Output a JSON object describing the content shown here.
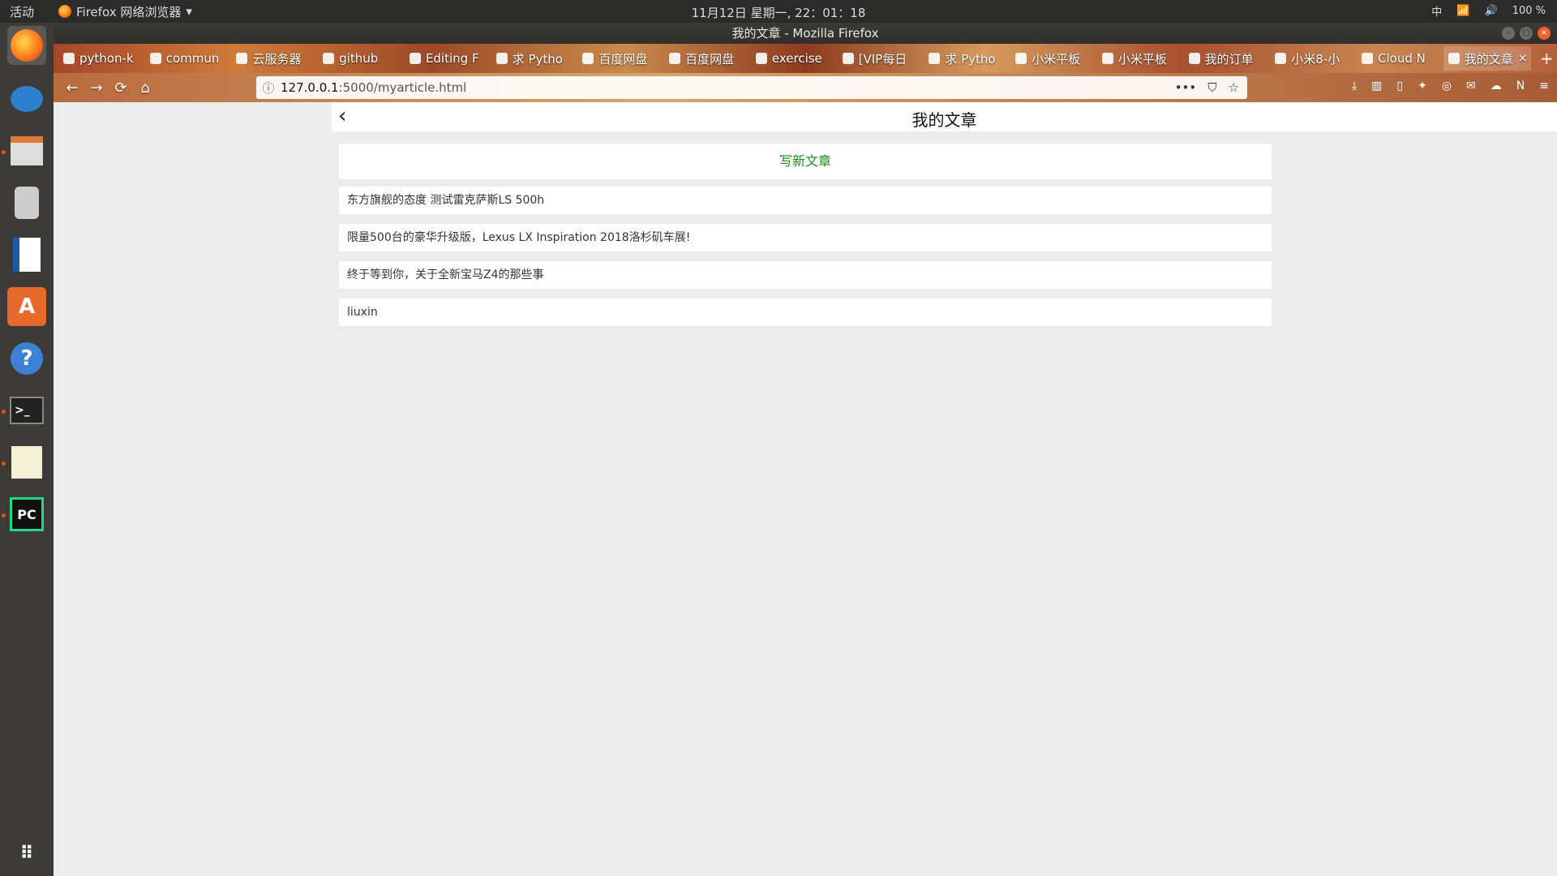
{
  "topbar": {
    "activities": "活动",
    "app_menu": "Firefox 网络浏览器",
    "clock": "11月12日 星期一, 22：01：18",
    "input_method": "中",
    "battery": "100 %"
  },
  "window": {
    "title": "我的文章 - Mozilla Firefox"
  },
  "tabs": [
    {
      "label": "python-k"
    },
    {
      "label": "commun"
    },
    {
      "label": "云服务器"
    },
    {
      "label": "github"
    },
    {
      "label": "Editing F"
    },
    {
      "label": "求 Pytho"
    },
    {
      "label": "百度网盘"
    },
    {
      "label": "百度网盘"
    },
    {
      "label": "exercise"
    },
    {
      "label": "[VIP每日"
    },
    {
      "label": "求 Pytho"
    },
    {
      "label": "小米平板"
    },
    {
      "label": "小米平板"
    },
    {
      "label": "我的订单"
    },
    {
      "label": "小米8-小"
    },
    {
      "label": "Cloud N"
    },
    {
      "label": "我的文章"
    }
  ],
  "navbar": {
    "url_host": "127.0.0.1",
    "url_path": ":5000/myarticle.html"
  },
  "page": {
    "title": "我的文章",
    "write_button": "写新文章",
    "articles": [
      "东方旗舰的态度 测试雷克萨斯LS 500h",
      "限量500台的豪华升级版，Lexus LX Inspiration 2018洛杉矶车展!",
      "终于等到你，关于全新宝马Z4的那些事",
      "liuxin"
    ]
  }
}
